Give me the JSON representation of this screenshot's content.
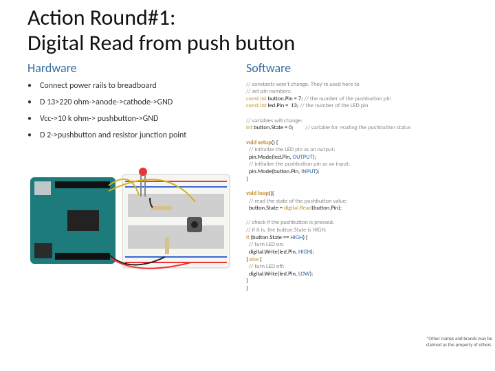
{
  "title_line1": "Action Round#1:",
  "title_line2": "Digital Read from push button",
  "hardware": {
    "heading": "Hardware",
    "items": [
      "Connect power rails to breadboard",
      "D 13>220 ohm->anode->cathode->GND",
      "Vcc->10 k ohm-> pushbutton->GND",
      "D 2->pushbutton and resistor junction point"
    ]
  },
  "software": {
    "heading": "Software",
    "code": {
      "c1": "// constants won't change. They're used here to",
      "c2": "// set pin numbers:",
      "l1a": "const int ",
      "l1b": "button.Pin = 7; ",
      "l1c": "// the number of the pushbutton pin",
      "l2a": "const int ",
      "l2b": "led.Pin =  13; ",
      "l2c": "// the number of the LED pin",
      "c3": "// variables will change:",
      "l3a": "int ",
      "l3b": "button.State = 0;         ",
      "l3c": "// variable for reading the pushbutton status",
      "l4a": "void setup",
      "l4b": "() {",
      "c4": "  // initialize the LED pin as an output:",
      "l5a": "  pin.Mode(led.Pin, ",
      "l5b": "OUTPUT",
      "l5c": ");",
      "c5": "  // initialize the pushbutton pin as an input:",
      "l6a": "  pin.Mode(button.Pin, ",
      "l6b": "INPUT",
      "l6c": ");",
      "l7": "}",
      "l8a": "void loop",
      "l8b": "(){",
      "c6": "  // read the state of the pushbutton value:",
      "l9a": "  button.State = ",
      "l9b": "digital.Read",
      "l9c": "(button.Pin);",
      "c7": "// check if the pushbutton is pressed.",
      "c8": "// if it is, the button.State is HIGH:",
      "l10a": "if ",
      "l10b": "(button.State == ",
      "l10c": "HIGH",
      "l10d": ") {",
      "c9": "  // turn LED on:",
      "l11a": "  digital.Write(led.Pin, ",
      "l11b": "HIGH",
      "l11c": ");",
      "l12a": "} ",
      "l12b": "else ",
      "l12c": "{",
      "c10": "  // turn LED off:",
      "l13a": "  digital.Write(led.Pin, ",
      "l13b": "LOW",
      "l13c": ");",
      "l14": "}",
      "l15": "}"
    }
  },
  "footnote_l1": "*Other names and brands may be",
  "footnote_l2": "claimed as the property of others"
}
